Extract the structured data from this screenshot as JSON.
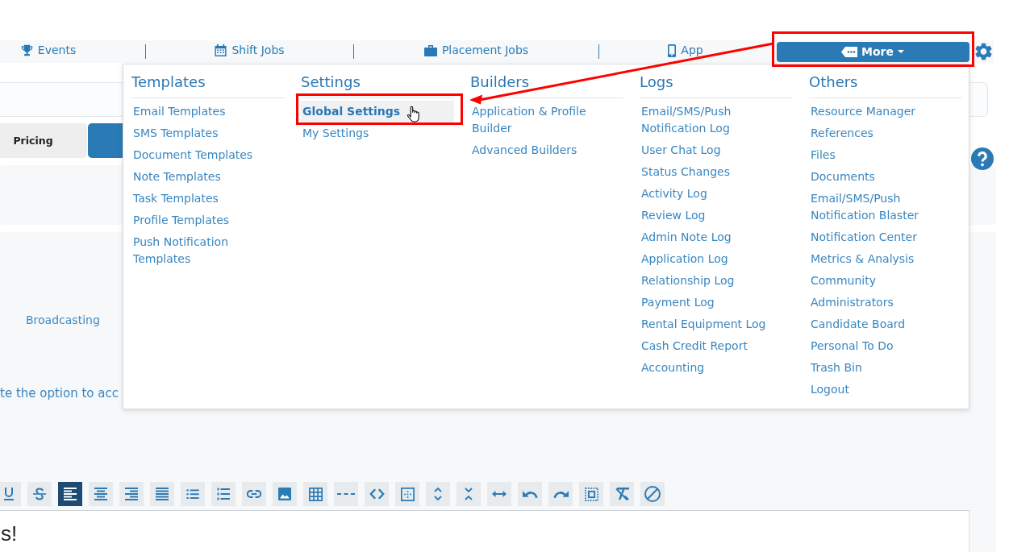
{
  "nav": {
    "items": [
      {
        "label": "Events"
      },
      {
        "label": "Shift Jobs"
      },
      {
        "label": "Placement Jobs"
      },
      {
        "label": "App"
      }
    ],
    "more_button": {
      "label": "More",
      "expanded": true
    }
  },
  "menu": {
    "columns": [
      {
        "heading": "Templates",
        "items": [
          {
            "label": "Email Templates",
            "selected": false
          },
          {
            "label": "SMS Templates",
            "selected": false
          },
          {
            "label": "Document Templates",
            "selected": false
          },
          {
            "label": "Note Templates",
            "selected": false
          },
          {
            "label": "Task Templates",
            "selected": false
          },
          {
            "label": "Profile Templates",
            "selected": false
          },
          {
            "label": "Push Notification Templates",
            "selected": false
          }
        ]
      },
      {
        "heading": "Settings",
        "items": [
          {
            "label": "Global Settings",
            "selected": true
          },
          {
            "label": "My Settings",
            "selected": false
          }
        ]
      },
      {
        "heading": "Builders",
        "items": [
          {
            "label": "Application & Profile Builder",
            "selected": false
          },
          {
            "label": "Advanced Builders",
            "selected": false
          }
        ]
      },
      {
        "heading": "Logs",
        "items": [
          {
            "label": "Email/SMS/Push Notification Log",
            "selected": false
          },
          {
            "label": "User Chat Log",
            "selected": false
          },
          {
            "label": "Status Changes",
            "selected": false
          },
          {
            "label": "Activity Log",
            "selected": false
          },
          {
            "label": "Review Log",
            "selected": false
          },
          {
            "label": "Admin Note Log",
            "selected": false
          },
          {
            "label": "Application Log",
            "selected": false
          },
          {
            "label": "Relationship Log",
            "selected": false
          },
          {
            "label": "Payment Log",
            "selected": false
          },
          {
            "label": "Rental Equipment Log",
            "selected": false
          },
          {
            "label": "Cash Credit Report",
            "selected": false
          },
          {
            "label": "Accounting",
            "selected": false
          }
        ]
      },
      {
        "heading": "Others",
        "items": [
          {
            "label": "Resource Manager",
            "selected": false
          },
          {
            "label": "References",
            "selected": false
          },
          {
            "label": "Files",
            "selected": false
          },
          {
            "label": "Documents",
            "selected": false
          },
          {
            "label": "Email/SMS/Push Notification Blaster",
            "selected": false
          },
          {
            "label": "Notification Center",
            "selected": false
          },
          {
            "label": "Metrics & Analysis",
            "selected": false
          },
          {
            "label": "Community",
            "selected": false
          },
          {
            "label": "Administrators",
            "selected": false
          },
          {
            "label": "Candidate Board",
            "selected": false
          },
          {
            "label": "Personal To Do",
            "selected": false
          },
          {
            "label": "Trash Bin",
            "selected": false
          },
          {
            "label": "Logout",
            "selected": false
          }
        ]
      }
    ]
  },
  "page": {
    "tabs": [
      {
        "label": "Pricing",
        "selected": false
      },
      {
        "selected": true
      }
    ],
    "sidebar_link": "Broadcasting",
    "description": "te the option to acc"
  },
  "editor": {
    "toolbar": [
      {
        "kind": "underline",
        "selected": false
      },
      {
        "kind": "strikethrough",
        "selected": false
      },
      {
        "kind": "align-left",
        "selected": true
      },
      {
        "kind": "align-center",
        "selected": false
      },
      {
        "kind": "align-right",
        "selected": false
      },
      {
        "kind": "justify",
        "selected": false
      },
      {
        "kind": "bullet-list",
        "selected": false
      },
      {
        "kind": "numbered-list",
        "selected": false
      },
      {
        "kind": "link",
        "selected": false
      },
      {
        "kind": "image",
        "selected": false
      },
      {
        "kind": "table",
        "selected": false
      },
      {
        "kind": "horizontal-rule",
        "selected": false
      },
      {
        "kind": "code",
        "selected": false
      },
      {
        "kind": "blocks",
        "selected": false
      },
      {
        "kind": "expand",
        "selected": false
      },
      {
        "kind": "collapse",
        "selected": false
      },
      {
        "kind": "stretch",
        "selected": false
      },
      {
        "kind": "undo",
        "selected": false
      },
      {
        "kind": "redo",
        "selected": false
      },
      {
        "kind": "fullscreen",
        "selected": false
      },
      {
        "kind": "clear-format",
        "selected": false
      },
      {
        "kind": "disable",
        "selected": false
      }
    ],
    "content": "s!"
  }
}
